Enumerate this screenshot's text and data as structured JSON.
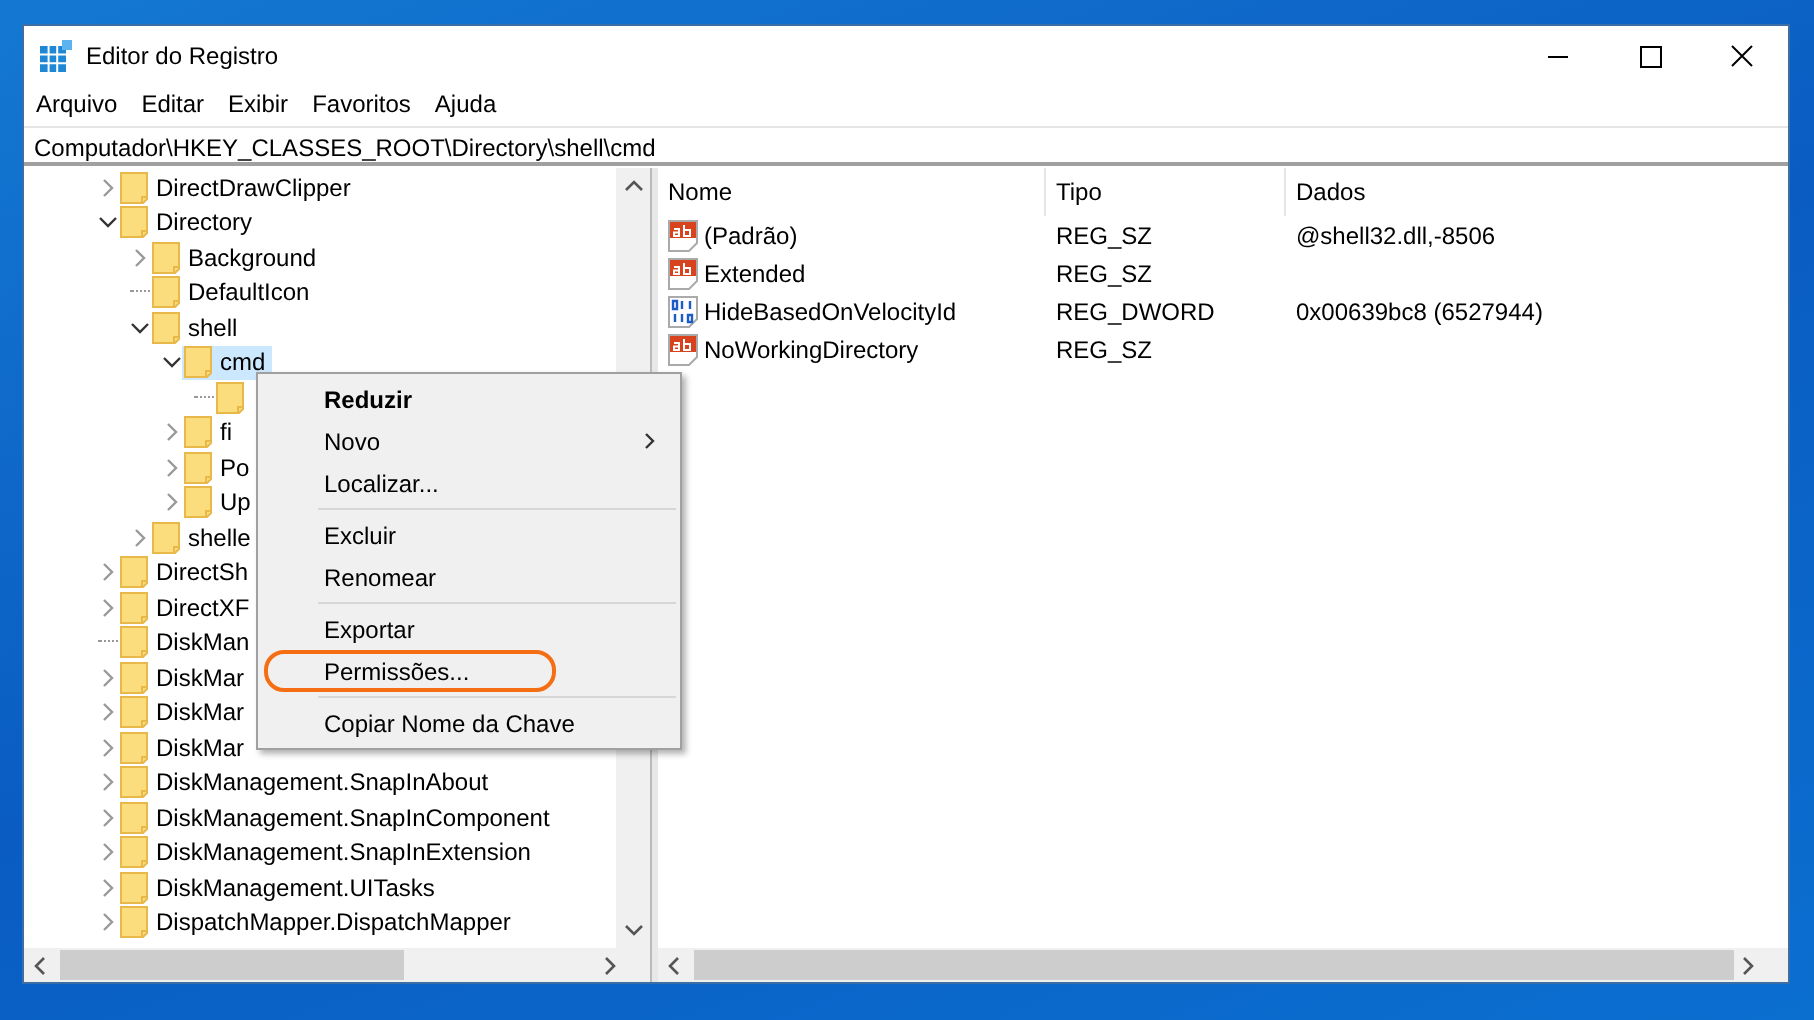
{
  "window": {
    "title": "Editor do Registro"
  },
  "menu_bar": [
    "Arquivo",
    "Editar",
    "Exibir",
    "Favoritos",
    "Ajuda"
  ],
  "address": "Computador\\HKEY_CLASSES_ROOT\\Directory\\shell\\cmd",
  "tree": [
    {
      "label": "DirectDrawClipper",
      "expanded": false,
      "selected": false
    },
    {
      "label": "Directory",
      "expanded": true,
      "selected": false,
      "children": [
        {
          "label": "Background",
          "expanded": false,
          "selected": false
        },
        {
          "label": "DefaultIcon",
          "selected": false
        },
        {
          "label": "shell",
          "expanded": true,
          "selected": false,
          "children": [
            {
              "label": "cmd",
              "expanded": true,
              "selected": true,
              "children": [
                {
                  "selected": false
                }
              ]
            },
            {
              "label": "fi",
              "expanded": false,
              "selected": false
            },
            {
              "label": "Po",
              "expanded": false,
              "selected": false
            },
            {
              "label": "Up",
              "expanded": false,
              "selected": false
            }
          ]
        },
        {
          "label": "shelle",
          "expanded": false,
          "selected": false
        }
      ]
    },
    {
      "label": "DirectSh",
      "expanded": false,
      "selected": false
    },
    {
      "label": "DirectXF",
      "expanded": false,
      "selected": false
    },
    {
      "label": "DiskMan",
      "selected": false
    },
    {
      "label": "DiskMar",
      "expanded": false,
      "selected": false
    },
    {
      "label": "DiskMar",
      "expanded": false,
      "selected": false
    },
    {
      "label": "DiskMar",
      "expanded": false,
      "selected": false
    },
    {
      "label": "DiskManagement.SnapInAbout",
      "expanded": false,
      "selected": false
    },
    {
      "label": "DiskManagement.SnapInComponent",
      "expanded": false,
      "selected": false
    },
    {
      "label": "DiskManagement.SnapInExtension",
      "expanded": false,
      "selected": false
    },
    {
      "label": "DiskManagement.UITasks",
      "expanded": false,
      "selected": false
    },
    {
      "label": "DispatchMapper.DispatchMapper",
      "expanded": false,
      "selected": false
    }
  ],
  "list": {
    "columns": [
      "Nome",
      "Tipo",
      "Dados"
    ],
    "rows": [
      {
        "kind": "string",
        "name": "(Padrão)",
        "type": "REG_SZ",
        "data": "@shell32.dll,-8506"
      },
      {
        "kind": "string",
        "name": "Extended",
        "type": "REG_SZ"
      },
      {
        "kind": "dword",
        "name": "HideBasedOnVelocityId",
        "type": "REG_DWORD",
        "data": "0x00639bc8 (6527944)"
      },
      {
        "kind": "string",
        "name": "NoWorkingDirectory",
        "type": "REG_SZ"
      }
    ]
  },
  "context_menu": [
    {
      "kind": "item",
      "label": "Reduzir",
      "default": true
    },
    {
      "kind": "submenu",
      "label": "Novo"
    },
    {
      "kind": "item",
      "label": "Localizar..."
    },
    {
      "kind": "separator"
    },
    {
      "kind": "item",
      "label": "Excluir"
    },
    {
      "kind": "item",
      "label": "Renomear"
    },
    {
      "kind": "separator"
    },
    {
      "kind": "item",
      "label": "Exportar"
    },
    {
      "kind": "item",
      "label": "Permissões...",
      "highlighted": true
    },
    {
      "kind": "separator"
    },
    {
      "kind": "item",
      "label": "Copiar Nome da Chave"
    }
  ]
}
